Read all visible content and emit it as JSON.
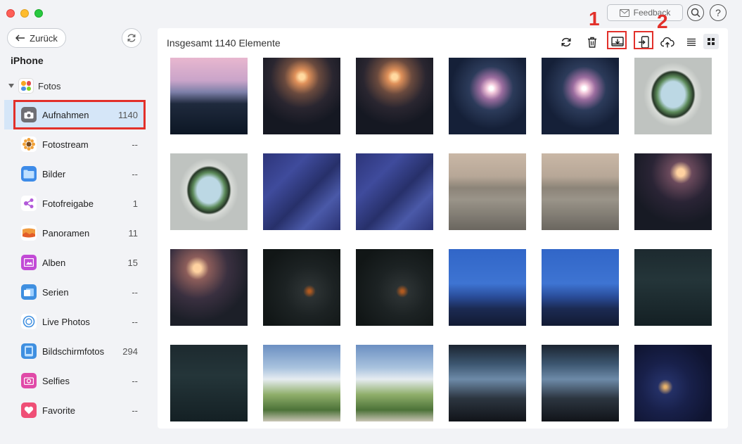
{
  "window": {
    "controls": [
      "close",
      "minimize",
      "maximize"
    ]
  },
  "topbar": {
    "feedback_label": "Feedback",
    "search_icon": "search-icon",
    "help_label": "?"
  },
  "sidebar": {
    "back_label": "Zurück",
    "device_name": "iPhone",
    "group_label": "Fotos",
    "items": [
      {
        "label": "Aufnahmen",
        "count": "1140",
        "icon": "camera-icon",
        "color": "#6e6e73"
      },
      {
        "label": "Fotostream",
        "count": "--",
        "icon": "sunflower-icon",
        "color": "#f2a23a"
      },
      {
        "label": "Bilder",
        "count": "--",
        "icon": "folder-icon",
        "color": "#3d8be8"
      },
      {
        "label": "Fotofreigabe",
        "count": "1",
        "icon": "share-icon",
        "color": "#b25ad9"
      },
      {
        "label": "Panoramen",
        "count": "11",
        "icon": "panorama-icon",
        "color": "#f09a3e"
      },
      {
        "label": "Alben",
        "count": "15",
        "icon": "album-icon",
        "color": "#c24ad6"
      },
      {
        "label": "Serien",
        "count": "--",
        "icon": "burst-icon",
        "color": "#3f8fe0"
      },
      {
        "label": "Live Photos",
        "count": "--",
        "icon": "live-photo-icon",
        "color": "#3f8fe0"
      },
      {
        "label": "Bildschirmfotos",
        "count": "294",
        "icon": "screenshot-icon",
        "color": "#3f8fe0"
      },
      {
        "label": "Selfies",
        "count": "--",
        "icon": "selfie-icon",
        "color": "#e04aa8"
      },
      {
        "label": "Favorite",
        "count": "--",
        "icon": "heart-icon",
        "color": "#ef4f76"
      }
    ]
  },
  "main": {
    "title": "Insgesamt 1140 Elemente",
    "annotations": {
      "step1": "1",
      "step2": "2"
    },
    "thumbnails": [
      "t-mountain",
      "t-fire",
      "t-fire",
      "t-fire2",
      "t-fire2",
      "t-window",
      "t-window",
      "t-blue",
      "t-blue",
      "t-sea",
      "t-sea",
      "t-moon",
      "t-moon2",
      "t-dark",
      "t-dark",
      "t-dusk",
      "t-dusk",
      "t-forest",
      "t-forest",
      "t-sky",
      "t-sky",
      "t-rain",
      "t-rain",
      "t-night"
    ]
  },
  "colors": {
    "accent_red": "#e2302a",
    "selection_blue": "#d5e6f8"
  }
}
